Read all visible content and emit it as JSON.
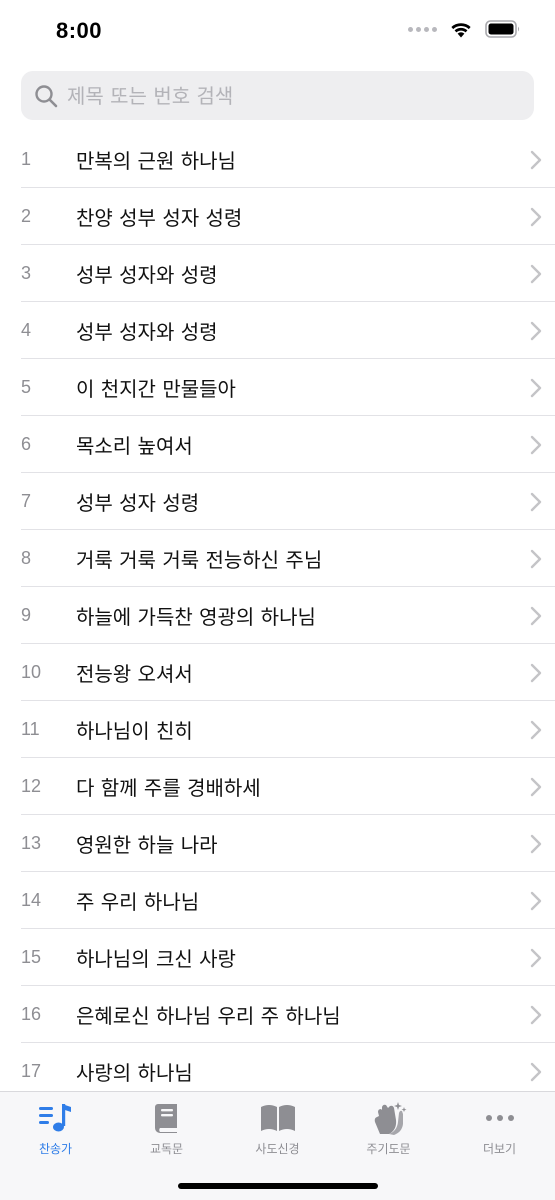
{
  "status_bar": {
    "time": "8:00"
  },
  "search": {
    "placeholder": "제목 또는 번호 검색",
    "value": ""
  },
  "hymns": [
    {
      "number": "1",
      "title": "만복의 근원 하나님"
    },
    {
      "number": "2",
      "title": "찬양 성부 성자 성령"
    },
    {
      "number": "3",
      "title": "성부 성자와 성령"
    },
    {
      "number": "4",
      "title": "성부 성자와 성령"
    },
    {
      "number": "5",
      "title": "이 천지간 만물들아"
    },
    {
      "number": "6",
      "title": "목소리 높여서"
    },
    {
      "number": "7",
      "title": "성부 성자 성령"
    },
    {
      "number": "8",
      "title": "거룩 거룩 거룩 전능하신 주님"
    },
    {
      "number": "9",
      "title": "하늘에 가득찬 영광의 하나님"
    },
    {
      "number": "10",
      "title": "전능왕 오셔서"
    },
    {
      "number": "11",
      "title": "하나님이 친히"
    },
    {
      "number": "12",
      "title": "다 함께 주를 경배하세"
    },
    {
      "number": "13",
      "title": "영원한 하늘 나라"
    },
    {
      "number": "14",
      "title": "주 우리 하나님"
    },
    {
      "number": "15",
      "title": "하나님의 크신 사랑"
    },
    {
      "number": "16",
      "title": "은혜로신 하나님 우리 주 하나님"
    },
    {
      "number": "17",
      "title": "사랑의 하나님"
    }
  ],
  "tabs": [
    {
      "label": "찬송가",
      "icon": "music-note-list-icon",
      "active": true
    },
    {
      "label": "교독문",
      "icon": "book-closed-icon",
      "active": false
    },
    {
      "label": "사도신경",
      "icon": "book-open-icon",
      "active": false
    },
    {
      "label": "주기도문",
      "icon": "hands-clap-icon",
      "active": false
    },
    {
      "label": "더보기",
      "icon": "more-dots-icon",
      "active": false
    }
  ],
  "colors": {
    "accent": "#2f7de8",
    "inactive": "#8e8e93",
    "separator": "#e2e2e6"
  }
}
